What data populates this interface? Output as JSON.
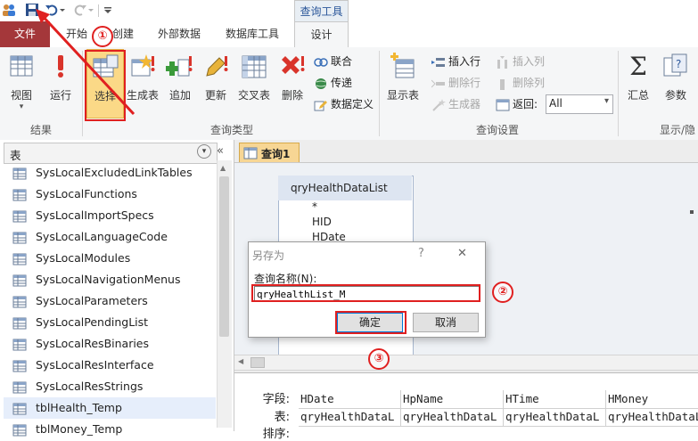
{
  "qat": {
    "icons": [
      "users-icon",
      "save-icon",
      "undo-icon",
      "redo-icon",
      "customize-icon"
    ]
  },
  "context_tab": {
    "label": "查询工具"
  },
  "tabs": [
    {
      "label": "文件"
    },
    {
      "label": "开始"
    },
    {
      "label": "创建"
    },
    {
      "label": "外部数据"
    },
    {
      "label": "数据库工具"
    },
    {
      "label": "设计"
    }
  ],
  "ribbon": {
    "results": {
      "label": "结果",
      "view": "视图",
      "run": "运行"
    },
    "query_type": {
      "label": "查询类型",
      "select": "选择",
      "make_table": "生成表",
      "append": "追加",
      "update": "更新",
      "crosstab": "交叉表",
      "delete": "删除",
      "union": "联合",
      "pass_through": "传递",
      "data_definition": "数据定义"
    },
    "query_setup": {
      "label": "查询设置",
      "show_table": "显示表",
      "insert_rows": "插入行",
      "delete_rows": "删除行",
      "builder": "生成器",
      "insert_columns": "插入列",
      "delete_columns": "删除列",
      "return_label": "返回:",
      "return_value": "All"
    },
    "show_hide": {
      "label": "显示/隐",
      "totals": "汇总",
      "parameters": "参数"
    }
  },
  "nav_pane": {
    "header": "表",
    "items": [
      "SysLocalExcludedLinkTables",
      "SysLocalFunctions",
      "SysLocalImportSpecs",
      "SysLocalLanguageCode",
      "SysLocalModules",
      "SysLocalNavigationMenus",
      "SysLocalParameters",
      "SysLocalPendingList",
      "SysLocalResBinaries",
      "SysLocalResInterface",
      "SysLocalResStrings",
      "tblHealth_Temp",
      "tblMoney_Temp"
    ]
  },
  "document": {
    "tab_label": "查询1",
    "table_box": {
      "title": "qryHealthDataList",
      "fields": [
        "*",
        "HID",
        "HDate"
      ]
    },
    "grid": {
      "row_labels": [
        "字段:",
        "表:",
        "排序:"
      ],
      "columns": [
        {
          "field": "HDate",
          "table": "qryHealthDataL"
        },
        {
          "field": "HpName",
          "table": "qryHealthDataL"
        },
        {
          "field": "HTime",
          "table": "qryHealthDataL"
        },
        {
          "field": "HMoney",
          "table": "qryHealthDataL"
        }
      ]
    }
  },
  "dialog": {
    "title": "另存为",
    "help": "?",
    "close": "✕",
    "field_label": "查询名称(N):",
    "input_value": "qryHealthList_M",
    "ok": "确定",
    "cancel": "取消"
  },
  "annotations": [
    "①",
    "②",
    "③"
  ],
  "colors": {
    "file_tab": "#a4373a",
    "annotation_red": "#e02020",
    "doc_tab": "#f7d694"
  }
}
